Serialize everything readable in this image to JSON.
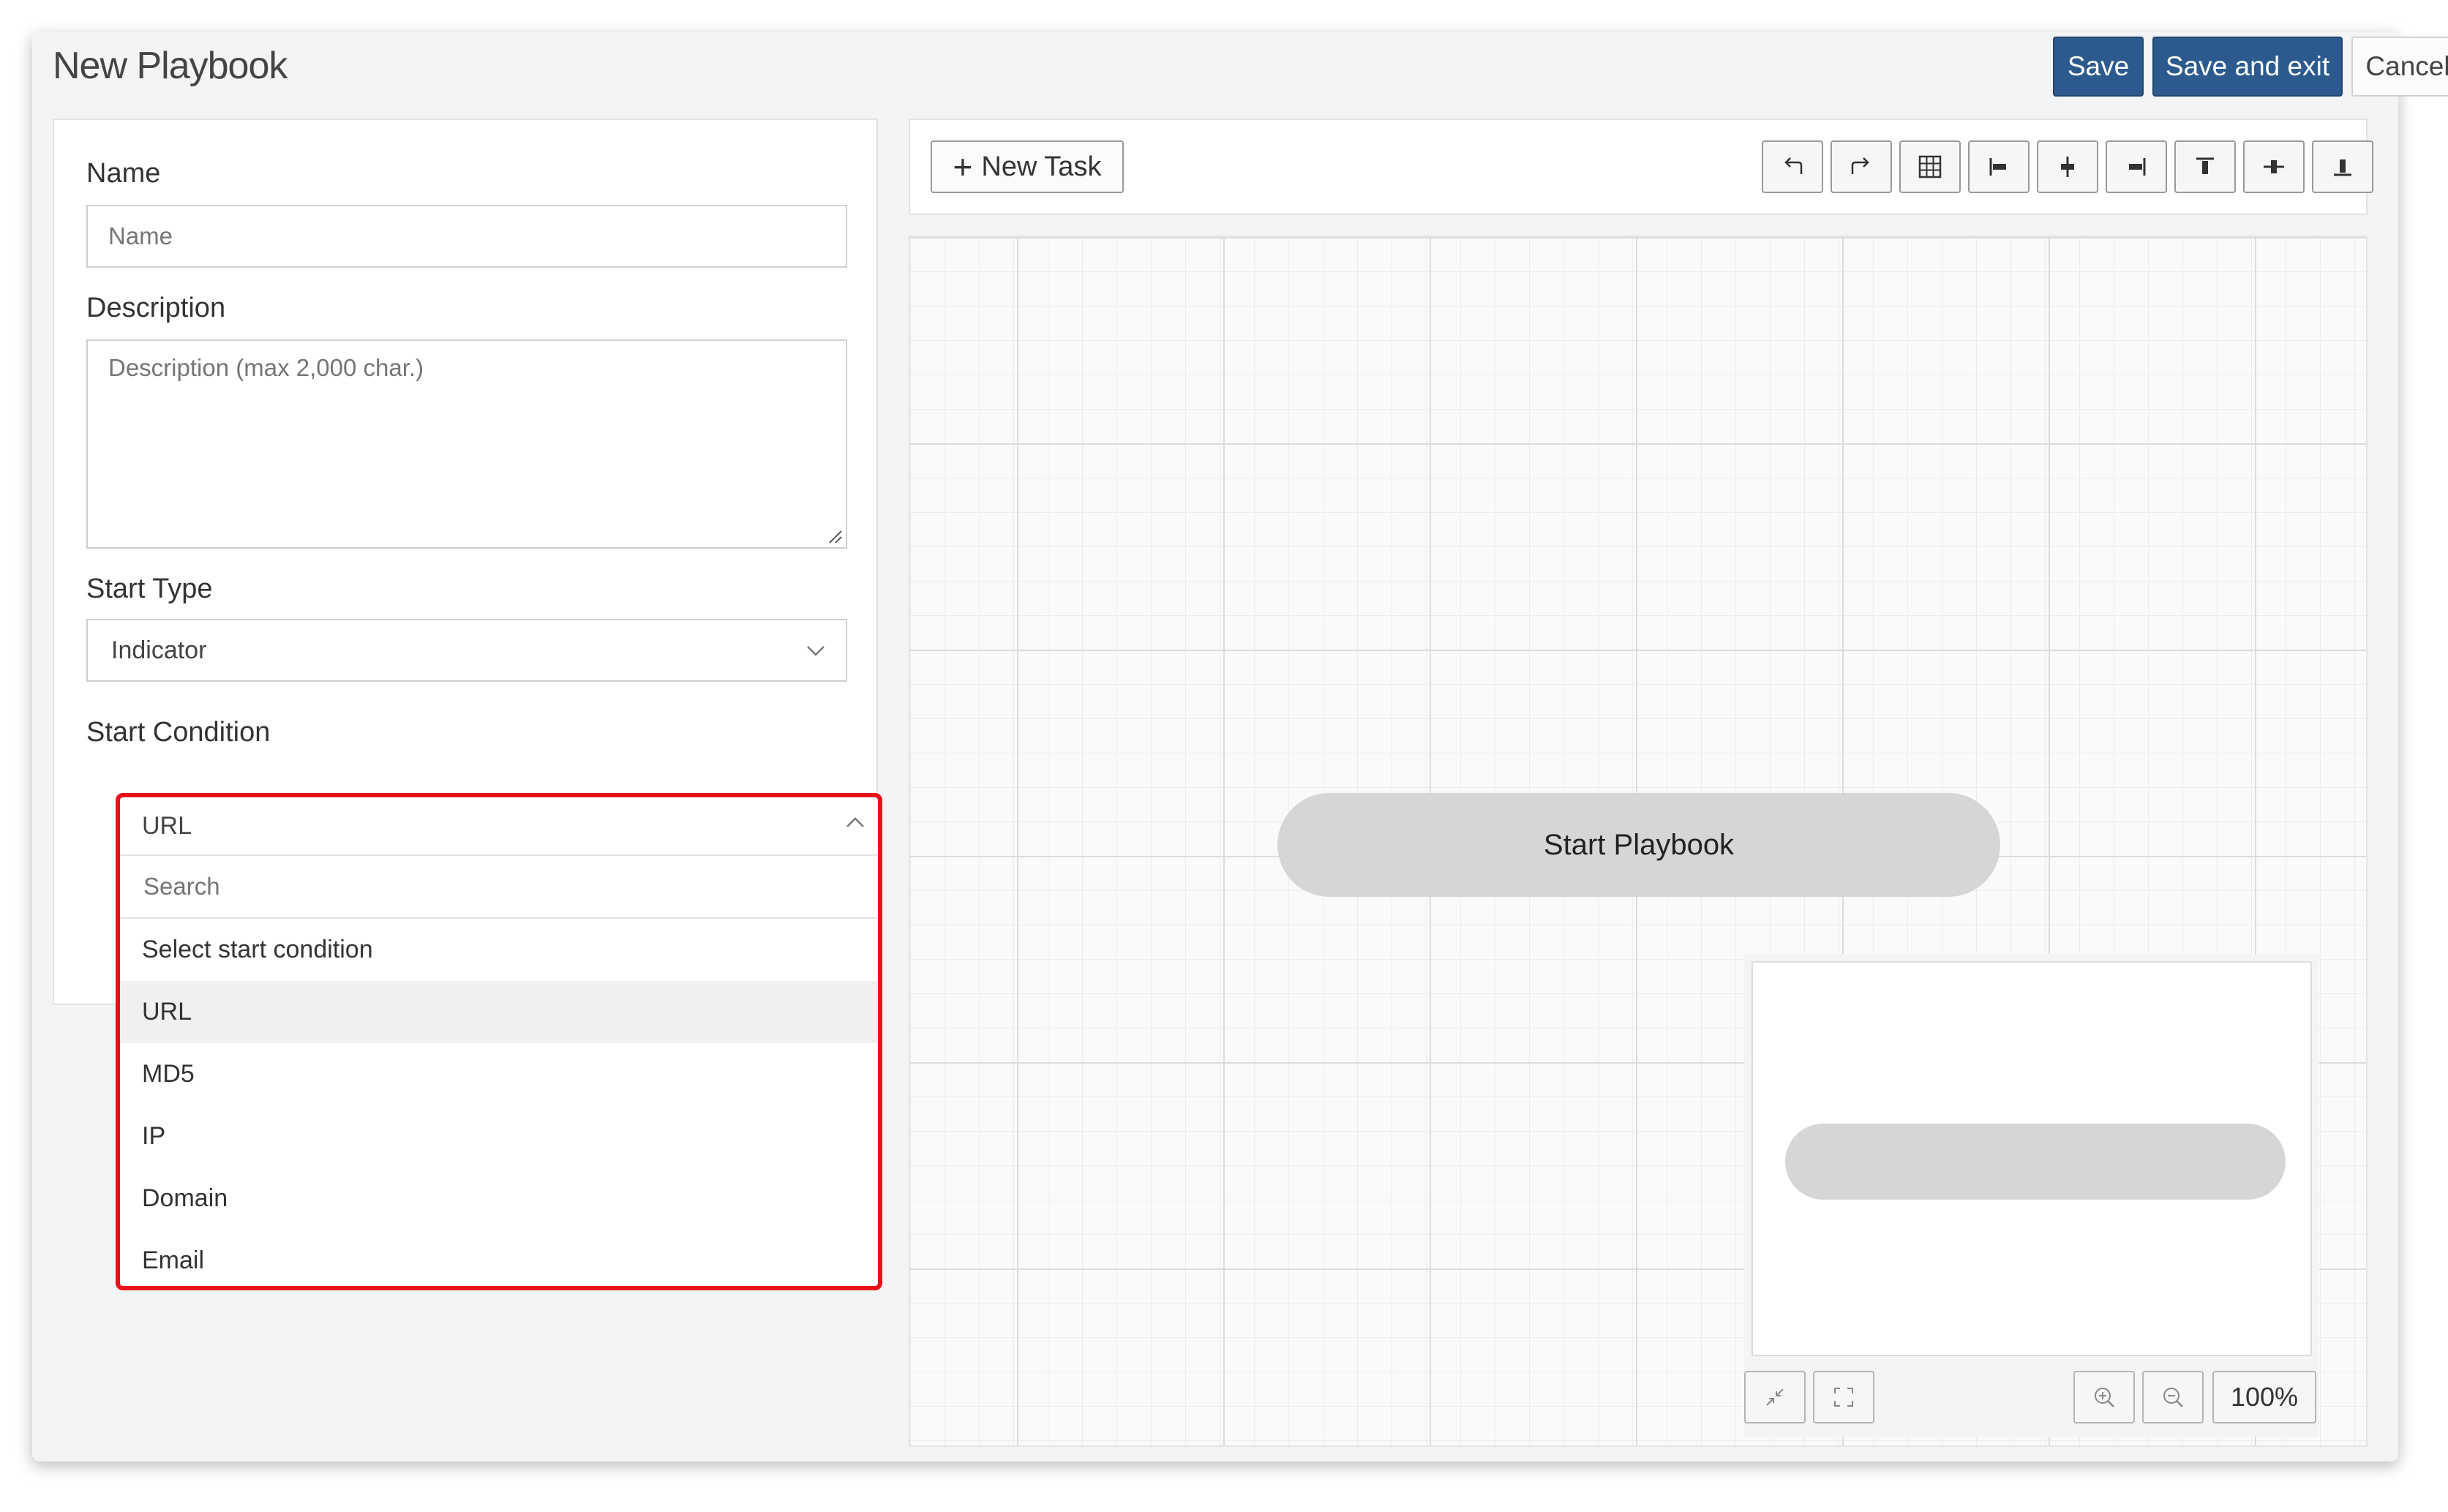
{
  "header": {
    "title": "New Playbook",
    "save_label": "Save",
    "save_exit_label": "Save and exit",
    "cancel_label": "Cancel"
  },
  "form": {
    "name_label": "Name",
    "name_placeholder": "Name",
    "description_label": "Description",
    "description_placeholder": "Description (max 2,000 char.)",
    "start_type_label": "Start Type",
    "start_type_value": "Indicator",
    "start_condition_label": "Start Condition",
    "start_condition_value": "URL",
    "search_placeholder": "Search",
    "options": [
      "Select start condition",
      "URL",
      "MD5",
      "IP",
      "Domain",
      "Email"
    ],
    "highlighted_option": "URL"
  },
  "toolbar": {
    "new_task_label": "New Task",
    "icons": [
      "undo-icon",
      "redo-icon",
      "grid-icon",
      "align-left-icon",
      "align-center-icon",
      "align-right-icon",
      "align-top-icon",
      "align-middle-icon",
      "align-bottom-icon"
    ]
  },
  "canvas": {
    "start_node_label": "Start Playbook"
  },
  "minimap": {
    "zoom_label": "100%"
  },
  "colors": {
    "primary": "#2c5a8e",
    "highlight_border": "#e8111a",
    "node_fill": "#d6d6d6"
  }
}
